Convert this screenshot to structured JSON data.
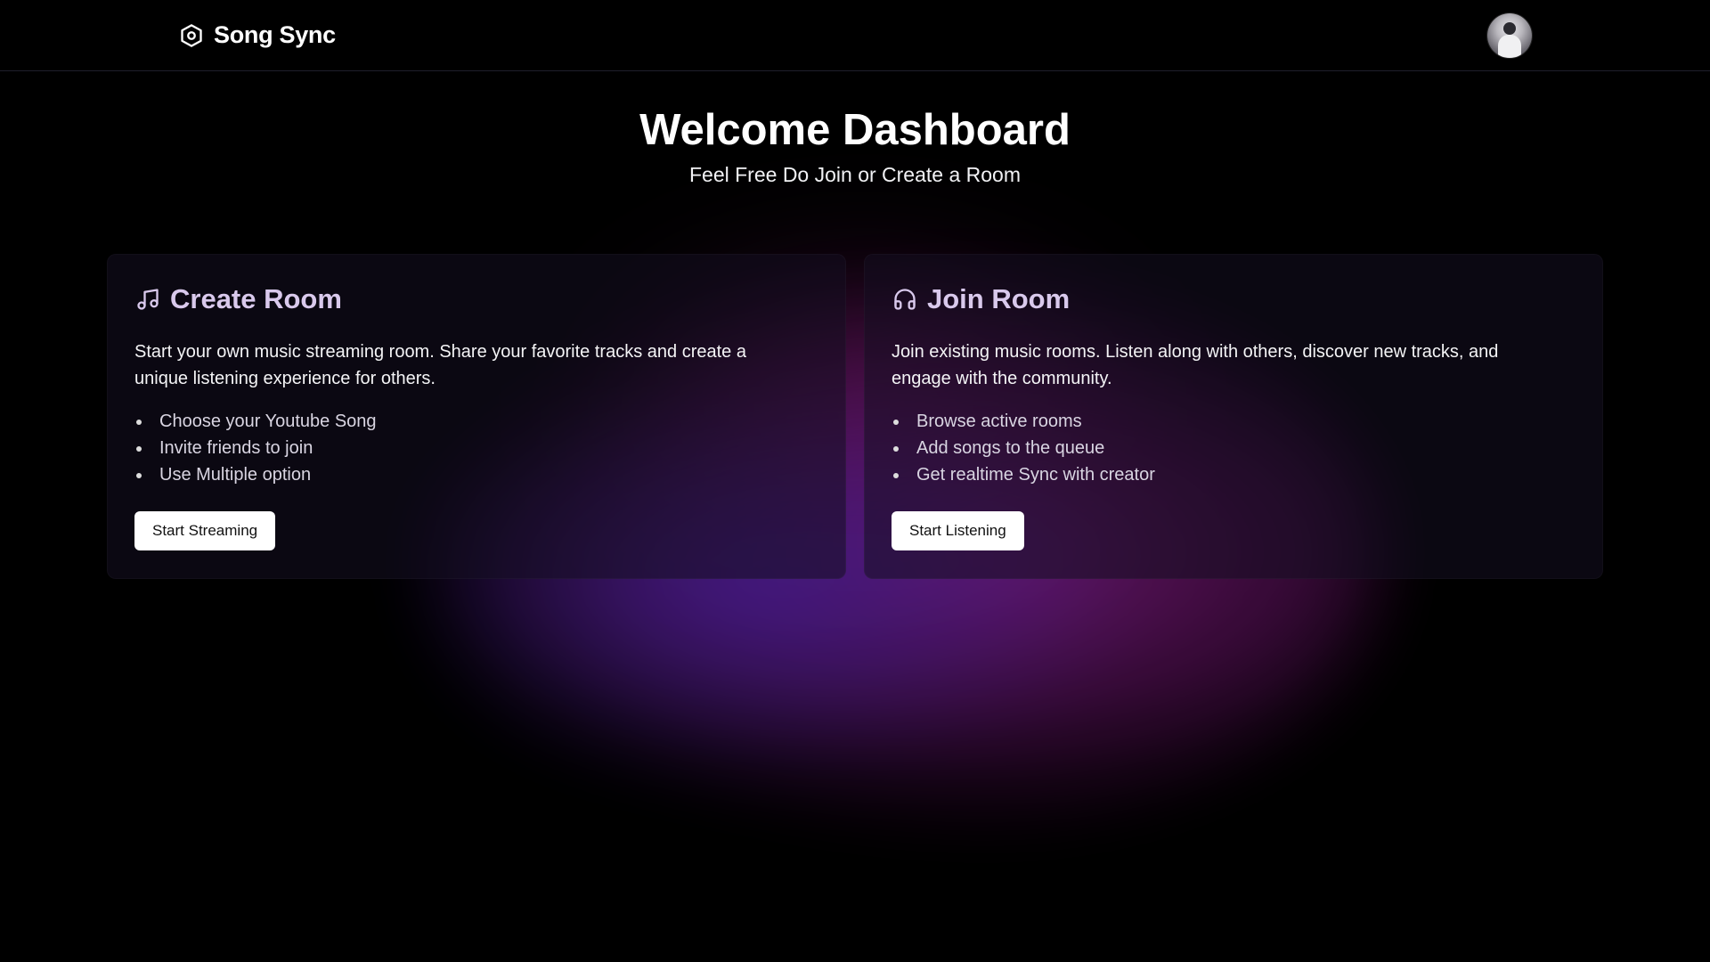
{
  "header": {
    "brand_name": "Song Sync",
    "brand_icon": "hexagon-settings-icon",
    "avatar": "user-avatar"
  },
  "hero": {
    "title": "Welcome Dashboard",
    "subtitle": "Feel Free Do Join or Create a Room"
  },
  "cards": {
    "create": {
      "icon": "music-note-icon",
      "title": "Create Room",
      "description": "Start your own music streaming room. Share your favorite tracks and create a unique listening experience for others.",
      "features": [
        "Choose your Youtube Song",
        "Invite friends to join",
        "Use Multiple option"
      ],
      "button_label": "Start Streaming"
    },
    "join": {
      "icon": "headphones-icon",
      "title": "Join Room",
      "description": "Join existing music rooms. Listen along with others, discover new tracks, and engage with the community.",
      "features": [
        "Browse active rooms",
        "Add songs to the queue",
        "Get realtime Sync with creator"
      ],
      "button_label": "Start Listening"
    }
  },
  "colors": {
    "background": "#000000",
    "card_title": "#d9c9ec",
    "glow_purple": "#781978",
    "glow_indigo": "#461e96",
    "button_bg": "#ffffff"
  }
}
